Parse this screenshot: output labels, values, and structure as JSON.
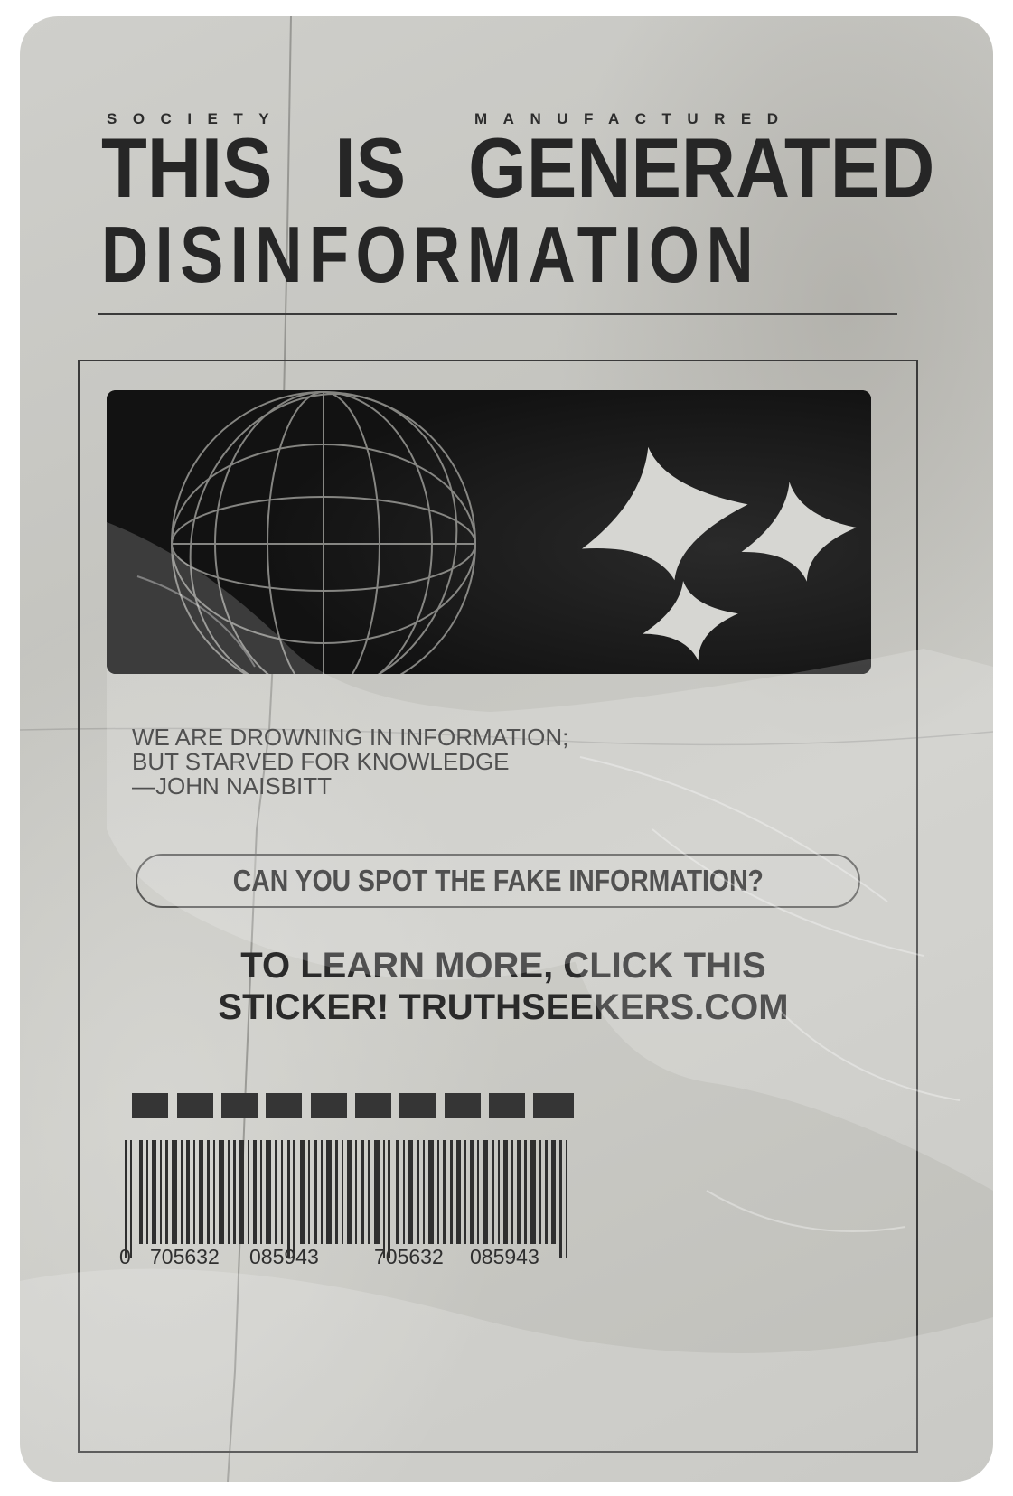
{
  "sticker": {
    "kicker_left": "SOCIETY",
    "kicker_right": "MANUFACTURED",
    "headline_line1": [
      "THIS",
      "IS",
      "GENERATED"
    ],
    "headline_line2": "DISINFORMATION",
    "quote": {
      "line1": "WE ARE DROWNING IN INFORMATION;",
      "line2": "BUT STARVED FOR KNOWLEDGE",
      "line3": "—JOHN NAISBITT"
    },
    "question": "CAN YOU SPOT THE FAKE INFORMATION?",
    "cta": {
      "line1": "TO LEARN MORE, CLICK THIS",
      "line2": "STICKER! TRUTHSEEKERS.COM"
    },
    "barcode": {
      "digit_lead": "0",
      "group1": "705632",
      "group2": "085943",
      "group3": "705632",
      "group4": "085943"
    },
    "hero_icons": [
      "wireframe-globe-icon",
      "sparkle-star-icon",
      "sparkle-star-icon",
      "sparkle-star-icon"
    ]
  },
  "colors": {
    "paper": "#c9c9c4",
    "ink": "#262626",
    "hero_bg": "#141414",
    "hero_fg": "#d6d6d2"
  }
}
